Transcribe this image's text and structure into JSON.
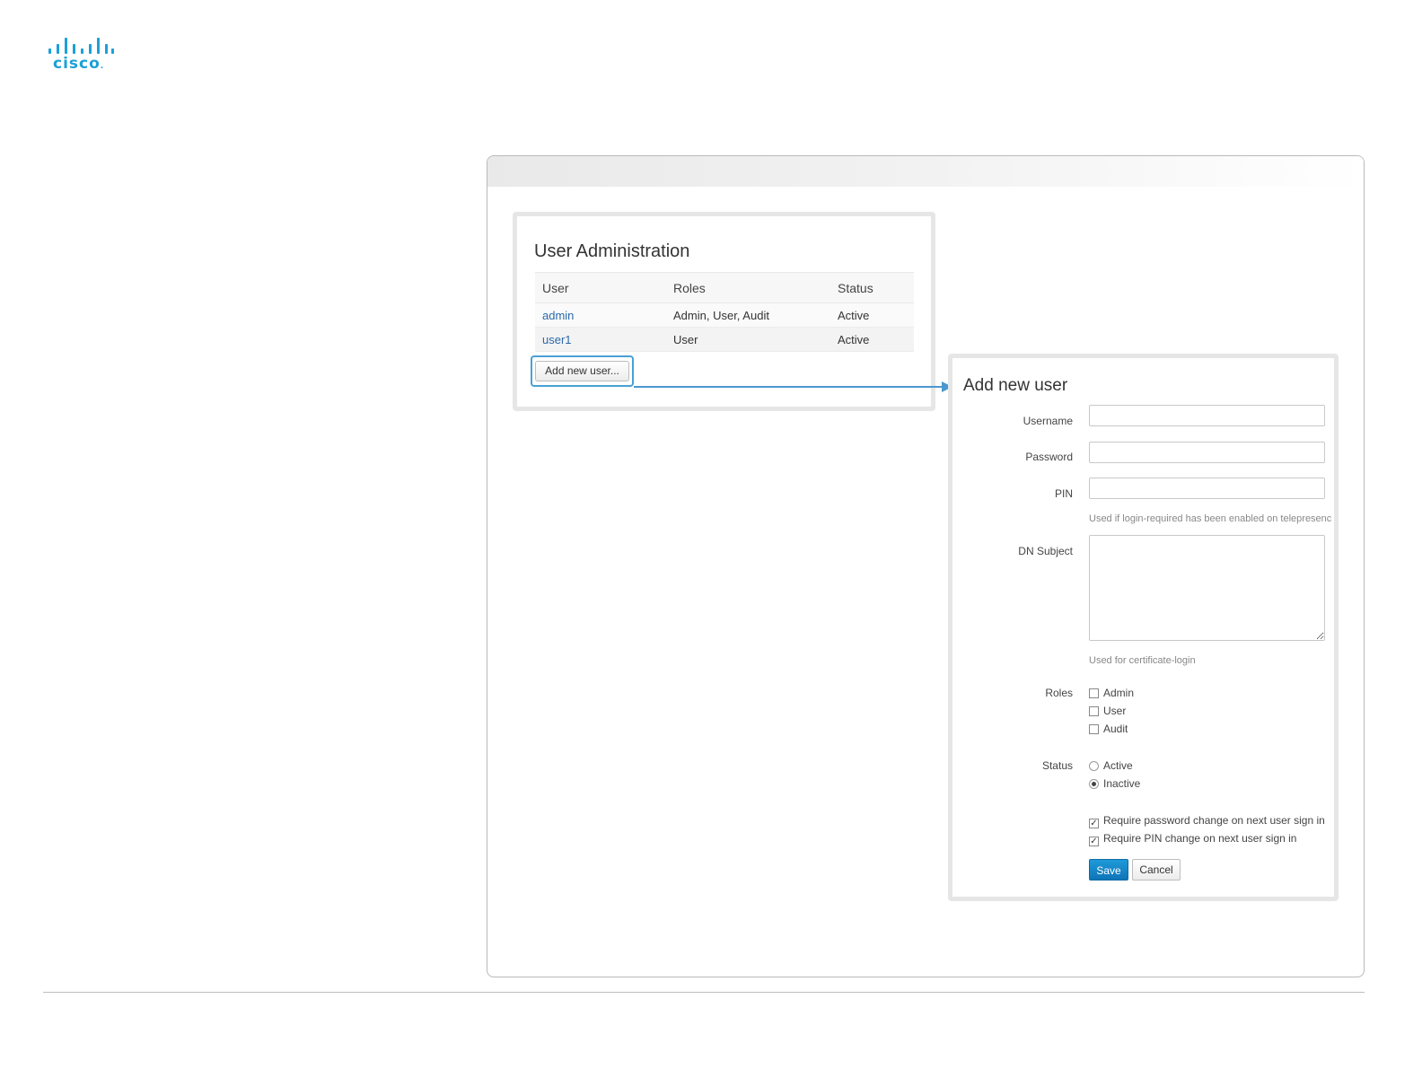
{
  "brand": {
    "name": "cisco",
    "accent": "#1ba0d7"
  },
  "admin_panel": {
    "title": "User Administration",
    "columns": [
      "User",
      "Roles",
      "Status"
    ],
    "rows": [
      {
        "user": "admin",
        "roles": "Admin, User, Audit",
        "status": "Active"
      },
      {
        "user": "user1",
        "roles": "User",
        "status": "Active"
      }
    ],
    "add_button": "Add new user..."
  },
  "add_user_form": {
    "title": "Add new user",
    "username_label": "Username",
    "password_label": "Password",
    "pin_label": "PIN",
    "pin_help": "Used if login-required has been enabled on telepresence",
    "dn_label": "DN Subject",
    "dn_help": "Used for certificate-login",
    "roles_label": "Roles",
    "roles": [
      {
        "label": "Admin",
        "checked": false
      },
      {
        "label": "User",
        "checked": false
      },
      {
        "label": "Audit",
        "checked": false
      }
    ],
    "status_label": "Status",
    "status_options": [
      {
        "label": "Active",
        "selected": false
      },
      {
        "label": "Inactive",
        "selected": true
      }
    ],
    "require_password_change": "Require password change on next user sign in",
    "require_pin_change": "Require PIN change on next user sign in",
    "save_label": "Save",
    "cancel_label": "Cancel"
  },
  "colors": {
    "primary_button": "#1488c8",
    "link": "#2b6aa8",
    "highlight": "#4aa0d5"
  }
}
